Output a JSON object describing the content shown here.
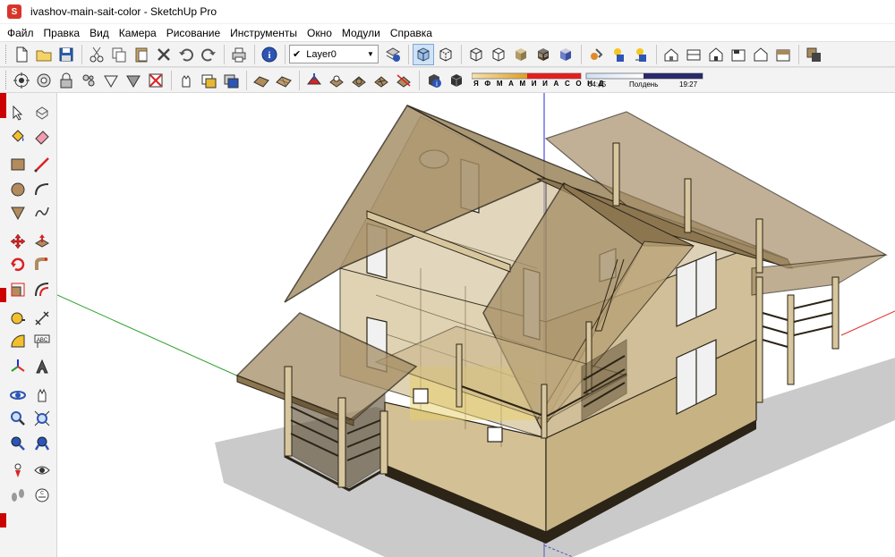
{
  "window": {
    "title": "ivashov-main-sait-color - SketchUp Pro"
  },
  "menu": [
    "Файл",
    "Правка",
    "Вид",
    "Камера",
    "Рисование",
    "Инструменты",
    "Окно",
    "Модули",
    "Справка"
  ],
  "layers": {
    "current": "Layer0"
  },
  "shadows": {
    "months_label": "Я Ф М А М И И А С О Н Д",
    "time_start": "04:45",
    "noon_label": "Полдень",
    "time_end": "19:27"
  },
  "toolbar_main_icons": [
    "new-icon",
    "open-icon",
    "save-icon",
    "cut-icon",
    "copy-icon",
    "paste-icon",
    "erase-icon",
    "undo-icon",
    "redo-icon",
    "print-icon",
    "info-icon"
  ],
  "toolbar_view_icons": [
    "xray-icon",
    "back-edges-icon",
    "wireframe-icon",
    "hidden-line-icon",
    "shaded-icon",
    "shaded-textures-icon",
    "monochrome-icon",
    "sandbox-icon",
    "components-icon",
    "upload-icon",
    "iso-view-icon",
    "top-view-icon",
    "front-view-icon",
    "right-view-icon",
    "back-view-icon",
    "left-view-icon",
    "shadows-toggle-icon"
  ],
  "left_tool_icons": [
    "select-icon",
    "make-component-icon",
    "paint-bucket-icon",
    "eraser-icon",
    "rectangle-icon",
    "line-icon",
    "circle-icon",
    "arc-icon",
    "polygon-icon",
    "freehand-icon",
    "move-icon",
    "push-pull-icon",
    "rotate-icon",
    "follow-me-icon",
    "scale-icon",
    "offset-icon",
    "tape-measure-icon",
    "dimension-icon",
    "protractor-icon",
    "text-icon",
    "axes-icon",
    "3d-text-icon",
    "orbit-icon",
    "pan-icon",
    "zoom-icon",
    "zoom-window-icon",
    "zoom-extents-icon",
    "previous-view-icon",
    "position-camera-icon",
    "look-around-icon",
    "walk-icon",
    "section-plane-icon"
  ],
  "colors": {
    "axis_red": "#e0302a",
    "axis_green": "#2aa02a",
    "axis_blue": "#2a2ae0",
    "wall_tan": "#cdb98b",
    "roof_tan": "#a48d64",
    "edge": "#2b2417"
  }
}
